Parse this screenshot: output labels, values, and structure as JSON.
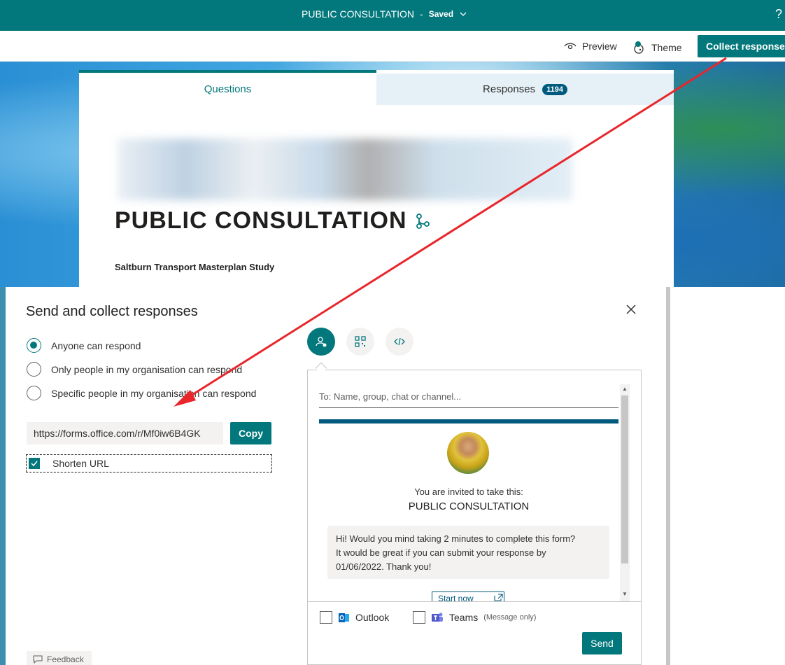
{
  "topbar": {
    "title": "PUBLIC CONSULTATION",
    "separator": "-",
    "status": "Saved",
    "help": "?"
  },
  "cmdbar": {
    "preview": "Preview",
    "theme": "Theme",
    "collect": "Collect responses"
  },
  "tabs": {
    "questions": "Questions",
    "responses": "Responses",
    "responses_count": "1194"
  },
  "form": {
    "title": "PUBLIC CONSULTATION",
    "subtitle": "Saltburn Transport Masterplan Study"
  },
  "panel": {
    "title": "Send and collect responses",
    "options": [
      {
        "label": "Anyone can respond",
        "selected": true
      },
      {
        "label": "Only people in my organisation can respond",
        "selected": false
      },
      {
        "label": "Specific people in my organisation can respond",
        "selected": false
      }
    ],
    "url": "https://forms.office.com/r/Mf0iw6B4GK",
    "copy": "Copy",
    "shorten": {
      "label": "Shorten URL",
      "checked": true
    },
    "feedback": "Feedback"
  },
  "share": {
    "to_placeholder": "To: Name, group, chat or channel...",
    "invite_text": "You are invited to take this:",
    "invite_form": "PUBLIC CONSULTATION",
    "message_line1": "Hi! Would you mind taking 2 minutes to complete this form?",
    "message_line2": "It would be great if you can submit your response by",
    "message_line3": "01/06/2022. Thank you!",
    "start": "Start now",
    "outlook": "Outlook",
    "teams": "Teams",
    "teams_note": "(Message only)",
    "send": "Send"
  },
  "colors": {
    "brand": "#03787c",
    "annotation_arrow": "#e8262b"
  }
}
